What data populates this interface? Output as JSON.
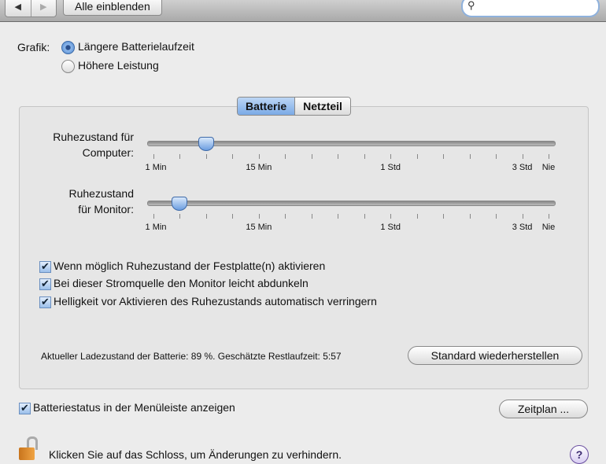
{
  "toolbar": {
    "back": "◀",
    "forward": "▶",
    "show_all": "Alle einblenden",
    "search_icon": "🔍"
  },
  "graphics": {
    "label": "Grafik:",
    "options": [
      {
        "label": "Längere Batterielaufzeit",
        "selected": true
      },
      {
        "label": "Höhere Leistung",
        "selected": false
      }
    ]
  },
  "tabs": [
    {
      "label": "Batterie",
      "selected": true
    },
    {
      "label": "Netzteil",
      "selected": false
    }
  ],
  "sliders": {
    "tick_labels": [
      "1 Min",
      "15 Min",
      "1 Std",
      "3 Std",
      "Nie"
    ],
    "computer": {
      "label1": "Ruhezustand für",
      "label2": "Computer:",
      "value_tick": 2,
      "tick_count": 16
    },
    "monitor": {
      "label1": "Ruhezustand",
      "label2": "für Monitor:",
      "value_tick": 1,
      "tick_count": 16
    }
  },
  "checkboxes": [
    {
      "label": "Wenn möglich Ruhezustand der Festplatte(n) aktivieren",
      "checked": true
    },
    {
      "label": "Bei dieser Stromquelle den Monitor leicht abdunkeln",
      "checked": true
    },
    {
      "label": "Helligkeit vor Aktivieren des Ruhezustands automatisch verringern",
      "checked": true
    }
  ],
  "status_text": "Aktueller Ladezustand der Batterie: 89 %. Geschätzte Restlaufzeit: 5:57",
  "restore_button": "Standard wiederherstellen",
  "menu_checkbox": {
    "label": "Batteriestatus in der Menüleiste anzeigen",
    "checked": true
  },
  "schedule_button": "Zeitplan ...",
  "lock_text": "Klicken Sie auf das Schloss, um Änderungen zu verhindern.",
  "help": "?"
}
